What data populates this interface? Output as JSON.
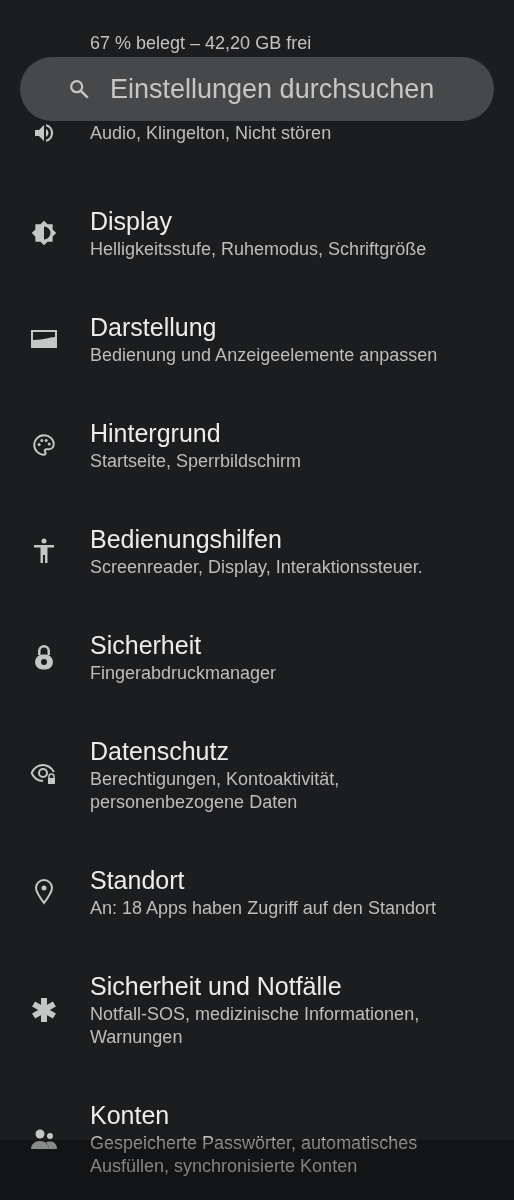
{
  "storage_summary": "67 % belegt – 42,20 GB frei",
  "search": {
    "placeholder": "Einstellungen durchsuchen"
  },
  "items": [
    {
      "subtitle": "Audio, Klingelton, Nicht stören"
    },
    {
      "title": "Display",
      "subtitle": "Helligkeitsstufe, Ruhemodus, Schriftgröße"
    },
    {
      "title": "Darstellung",
      "subtitle": "Bedienung und Anzeigeelemente anpassen"
    },
    {
      "title": "Hintergrund",
      "subtitle": "Startseite, Sperrbildschirm"
    },
    {
      "title": "Bedienungshilfen",
      "subtitle": "Screenreader, Display, Interaktionssteuer."
    },
    {
      "title": "Sicherheit",
      "subtitle": "Fingerabdruckmanager"
    },
    {
      "title": "Datenschutz",
      "subtitle": "Berechtigungen, Kontoaktivität, personenbezogene Daten"
    },
    {
      "title": "Standort",
      "subtitle": "An: 18 Apps haben Zugriff auf den Standort"
    },
    {
      "title": "Sicherheit und Notfälle",
      "subtitle": "Notfall-SOS, medizinische Informationen, Warnungen"
    },
    {
      "title": "Konten",
      "subtitle": "Gespeicherte Passwörter, automatisches Ausfüllen, synchronisierte Konten"
    }
  ]
}
